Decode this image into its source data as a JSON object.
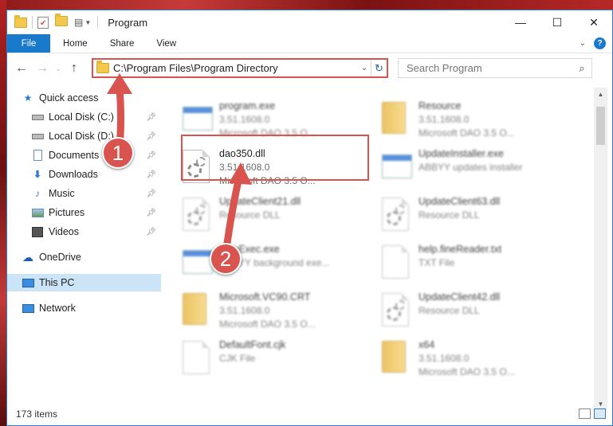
{
  "window": {
    "title": "Program"
  },
  "ribbon": {
    "tabs": [
      "File",
      "Home",
      "Share",
      "View"
    ]
  },
  "address": {
    "path": "C:\\Program Files\\Program Directory"
  },
  "search": {
    "placeholder": "Search Program"
  },
  "sidebar": {
    "items": [
      {
        "label": "Quick access",
        "icon": "star-icon",
        "pinned": false
      },
      {
        "label": "Local Disk (C:)",
        "icon": "drive-icon",
        "pinned": true
      },
      {
        "label": "Local Disk (D:)",
        "icon": "drive-icon",
        "pinned": true
      },
      {
        "label": "Documents",
        "icon": "documents-icon",
        "pinned": true
      },
      {
        "label": "Downloads",
        "icon": "downloads-icon",
        "pinned": true
      },
      {
        "label": "Music",
        "icon": "music-icon",
        "pinned": true
      },
      {
        "label": "Pictures",
        "icon": "pictures-icon",
        "pinned": true
      },
      {
        "label": "Videos",
        "icon": "videos-icon",
        "pinned": true
      },
      {
        "label": "OneDrive",
        "icon": "cloud-icon",
        "pinned": false
      },
      {
        "label": "This PC",
        "icon": "computer-icon",
        "pinned": false,
        "selected": true
      },
      {
        "label": "Network",
        "icon": "network-icon",
        "pinned": false
      }
    ]
  },
  "files": {
    "left": [
      {
        "name": "program.exe",
        "line1": "3.51.1608.0",
        "line2": "Microsoft DAO 3.5 O...",
        "icon": "exe-icon"
      },
      {
        "name": "dao350.dll",
        "line1": "3.51.1608.0",
        "line2": "Microsoft DAO 3.5 O...",
        "icon": "dll-gear-icon"
      },
      {
        "name": "UpdateClient21.dll",
        "line1": "Resource DLL",
        "line2": "",
        "icon": "dll-gear-icon"
      },
      {
        "name": "FineExec.exe",
        "line1": "ABBYY background exe...",
        "line2": "",
        "icon": "exe-icon"
      },
      {
        "name": "Microsoft.VC90.CRT",
        "line1": "3.51.1608.0",
        "line2": "Microsoft DAO 3.5 O...",
        "icon": "folder-icon"
      },
      {
        "name": "DefaultFont.cjk",
        "line1": "CJK File",
        "line2": "",
        "icon": "file-icon"
      }
    ],
    "right": [
      {
        "name": "Resource",
        "line1": "3.51.1608.0",
        "line2": "Microsoft DAO 3.5 O...",
        "icon": "folder-icon"
      },
      {
        "name": "UpdateInstaller.exe",
        "line1": "ABBYY updates installer",
        "line2": "",
        "icon": "exe-icon"
      },
      {
        "name": "UpdateClient63.dll",
        "line1": "Resource DLL",
        "line2": "",
        "icon": "dll-gear-icon"
      },
      {
        "name": "help.fineReader.txt",
        "line1": "TXT File",
        "line2": "",
        "icon": "file-icon"
      },
      {
        "name": "UpdateClient42.dll",
        "line1": "Resource DLL",
        "line2": "",
        "icon": "dll-gear-icon"
      },
      {
        "name": "x64",
        "line1": "3.51.1608.0",
        "line2": "Microsoft DAO 3.5 O...",
        "icon": "folder-icon"
      }
    ]
  },
  "status": {
    "count": "173 items"
  },
  "annotations": {
    "badge1": "1",
    "badge2": "2",
    "accent": "#d9534f"
  }
}
